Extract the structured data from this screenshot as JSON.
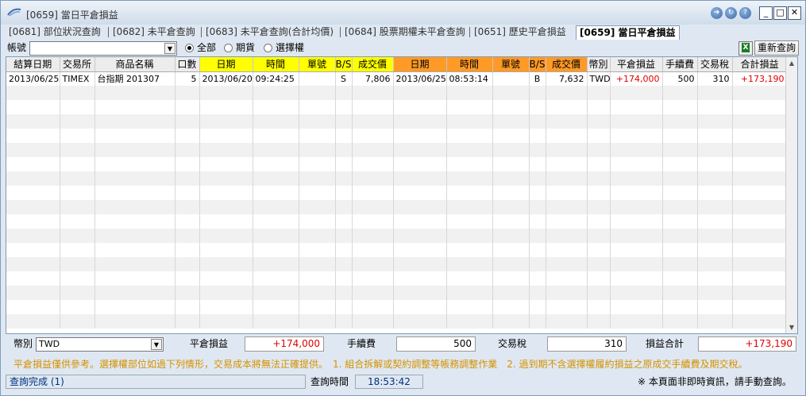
{
  "window": {
    "title": "[0659] 當日平倉損益"
  },
  "tabs": [
    {
      "label": "[0681] 部位狀況查詢"
    },
    {
      "label": "[0682] 未平倉查詢"
    },
    {
      "label": "[0683] 未平倉查詢(合計均價)"
    },
    {
      "label": "[0684] 股票期權未平倉查詢"
    },
    {
      "label": "[0651] 歷史平倉損益"
    },
    {
      "label": "[0659] 當日平倉損益"
    }
  ],
  "toolbar": {
    "account_label": "帳號",
    "account_value": "",
    "filter_all": "全部",
    "filter_futures": "期貨",
    "filter_options": "選擇權",
    "refresh_label": "重新查詢"
  },
  "table": {
    "headers": [
      "結算日期",
      "交易所",
      "商品名稱",
      "口數",
      "日期",
      "時間",
      "單號",
      "B/S",
      "成交價",
      "日期",
      "時間",
      "單號",
      "B/S",
      "成交價",
      "幣別",
      "平倉損益",
      "手續費",
      "交易稅",
      "合計損益"
    ],
    "rows": [
      [
        "2013/06/25",
        "TIMEX",
        "台指期 201307",
        "5",
        "2013/06/20",
        "09:24:25",
        "",
        "S",
        "7,806",
        "2013/06/25",
        "08:53:14",
        "",
        "B",
        "7,632",
        "TWD",
        "+174,000",
        "500",
        "310",
        "+173,190"
      ]
    ]
  },
  "summary": {
    "currency_label": "幣別",
    "currency_value": "TWD",
    "close_pl_label": "平倉損益",
    "close_pl_value": "+174,000",
    "fee_label": "手續費",
    "fee_value": "500",
    "tax_label": "交易稅",
    "tax_value": "310",
    "total_label": "損益合計",
    "total_value": "+173,190"
  },
  "note": "平倉損益僅供參考。選擇權部位如過下列情形，交易成本將無法正確提供。　1. 組合拆解或契約調整等帳務調整作業　2. 過到期不含選擇權履約損益之原成交手續費及期交稅。",
  "status": {
    "message": "查詢完成 (1)",
    "time_label": "查詢時間",
    "time_value": "18:53:42",
    "disclaimer": "※ 本頁面非即時資訊，請手動查詢。"
  },
  "colors": {
    "yellow_header": "#ffff00",
    "orange_header": "#ff9a26",
    "positive": "#e00000",
    "note": "#d69100"
  },
  "icons": [
    "app-logo-icon",
    "forward-icon",
    "refresh-icon",
    "help-icon",
    "minimize-icon",
    "maximize-icon",
    "close-icon",
    "excel-icon",
    "dropdown-arrow-icon",
    "scroll-up-icon",
    "scroll-down-icon"
  ]
}
